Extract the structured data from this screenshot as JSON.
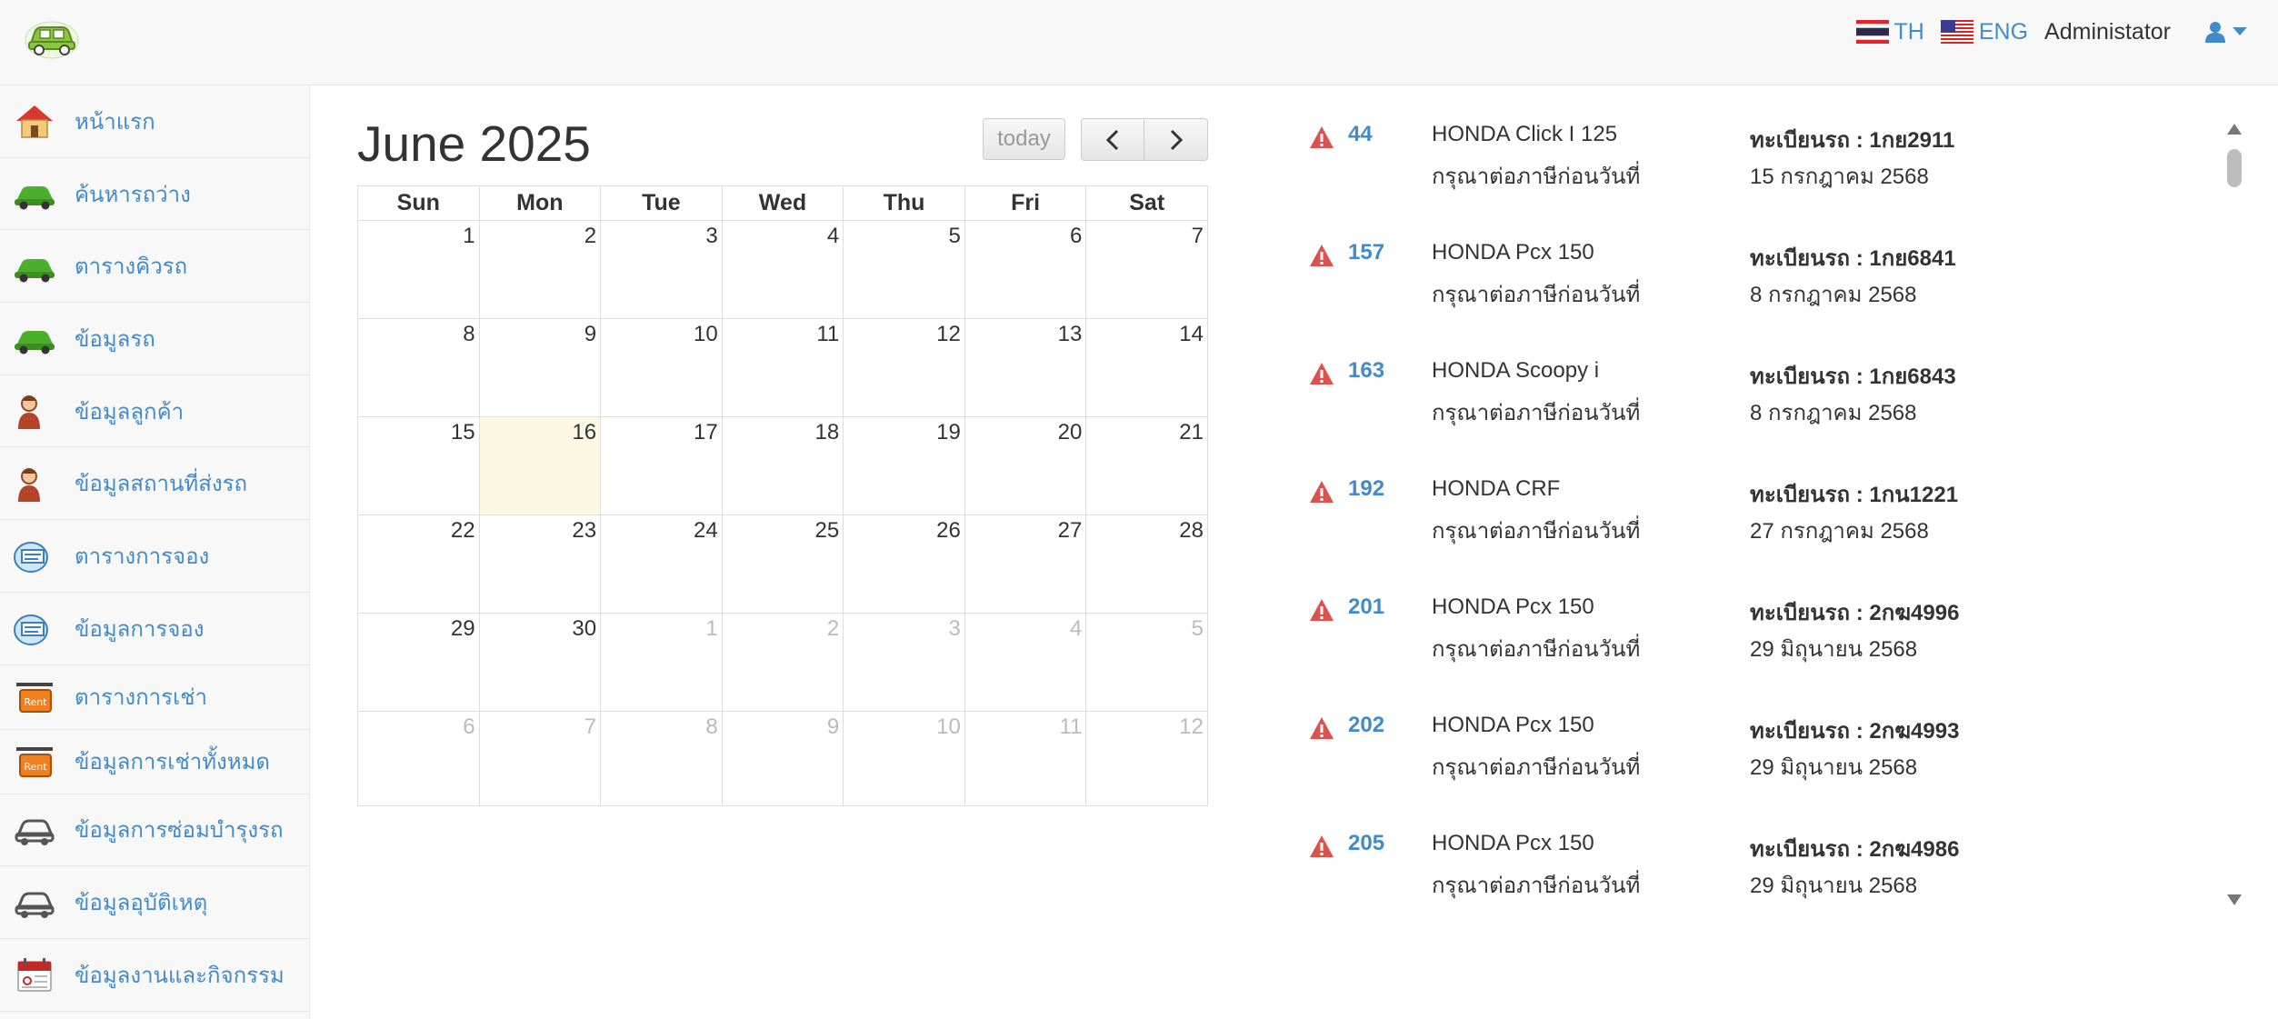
{
  "header": {
    "lang_th": "TH",
    "lang_eng": "ENG",
    "user_name": "Administator"
  },
  "sidebar": {
    "items": [
      {
        "label": "หน้าแรก",
        "icon": "home-icon"
      },
      {
        "label": "ค้นหารถว่าง",
        "icon": "green-car-icon"
      },
      {
        "label": "ตารางคิวรถ",
        "icon": "green-car-icon"
      },
      {
        "label": "ข้อมูลรถ",
        "icon": "green-car-icon"
      },
      {
        "label": "ข้อมูลลูกค้า",
        "icon": "person-icon"
      },
      {
        "label": "ข้อมูลสถานที่ส่งรถ",
        "icon": "person-icon"
      },
      {
        "label": "ตารางการจอง",
        "icon": "booking-icon"
      },
      {
        "label": "ข้อมูลการจอง",
        "icon": "booking-icon"
      },
      {
        "label": "ตารางการเช่า",
        "icon": "rent-sign-icon"
      },
      {
        "label": "ข้อมูลการเช่าทั้งหมด",
        "icon": "rent-sign-icon"
      },
      {
        "label": "ข้อมูลการซ่อมบำรุงรถ",
        "icon": "grey-car-icon"
      },
      {
        "label": "ข้อมูลอุบัติเหตุ",
        "icon": "grey-car-icon"
      },
      {
        "label": "ข้อมูลงานและกิจกรรม",
        "icon": "calendar-icon"
      }
    ]
  },
  "calendar": {
    "title": "June 2025",
    "today_label": "today",
    "weekdays": [
      "Sun",
      "Mon",
      "Tue",
      "Wed",
      "Thu",
      "Fri",
      "Sat"
    ],
    "weeks": [
      [
        {
          "d": "1"
        },
        {
          "d": "2"
        },
        {
          "d": "3"
        },
        {
          "d": "4"
        },
        {
          "d": "5"
        },
        {
          "d": "6"
        },
        {
          "d": "7"
        }
      ],
      [
        {
          "d": "8"
        },
        {
          "d": "9"
        },
        {
          "d": "10"
        },
        {
          "d": "11"
        },
        {
          "d": "12"
        },
        {
          "d": "13"
        },
        {
          "d": "14"
        }
      ],
      [
        {
          "d": "15"
        },
        {
          "d": "16",
          "today": true
        },
        {
          "d": "17"
        },
        {
          "d": "18"
        },
        {
          "d": "19"
        },
        {
          "d": "20"
        },
        {
          "d": "21"
        }
      ],
      [
        {
          "d": "22"
        },
        {
          "d": "23"
        },
        {
          "d": "24"
        },
        {
          "d": "25"
        },
        {
          "d": "26"
        },
        {
          "d": "27"
        },
        {
          "d": "28"
        }
      ],
      [
        {
          "d": "29"
        },
        {
          "d": "30"
        },
        {
          "d": "1",
          "other": true
        },
        {
          "d": "2",
          "other": true
        },
        {
          "d": "3",
          "other": true
        },
        {
          "d": "4",
          "other": true
        },
        {
          "d": "5",
          "other": true
        }
      ],
      [
        {
          "d": "6",
          "other": true
        },
        {
          "d": "7",
          "other": true
        },
        {
          "d": "8",
          "other": true
        },
        {
          "d": "9",
          "other": true
        },
        {
          "d": "10",
          "other": true
        },
        {
          "d": "11",
          "other": true
        },
        {
          "d": "12",
          "other": true
        }
      ]
    ]
  },
  "alerts": {
    "note_label": "กรุณาต่อภาษีก่อนวันที่",
    "items": [
      {
        "id": "44",
        "model": "HONDA Click I 125",
        "plate": "ทะเบียนรถ : 1กย2911",
        "date": "15 กรกฎาคม 2568"
      },
      {
        "id": "157",
        "model": "HONDA Pcx 150",
        "plate": "ทะเบียนรถ : 1กย6841",
        "date": "8 กรกฎาคม 2568"
      },
      {
        "id": "163",
        "model": "HONDA Scoopy i",
        "plate": "ทะเบียนรถ : 1กย6843",
        "date": "8 กรกฎาคม 2568"
      },
      {
        "id": "192",
        "model": "HONDA CRF",
        "plate": "ทะเบียนรถ : 1กน1221",
        "date": "27 กรกฎาคม 2568"
      },
      {
        "id": "201",
        "model": "HONDA Pcx 150",
        "plate": "ทะเบียนรถ : 2กฆ4996",
        "date": "29 มิถุนายน 2568"
      },
      {
        "id": "202",
        "model": "HONDA Pcx 150",
        "plate": "ทะเบียนรถ : 2กฆ4993",
        "date": "29 มิถุนายน 2568"
      },
      {
        "id": "205",
        "model": "HONDA Pcx 150",
        "plate": "ทะเบียนรถ : 2กฆ4986",
        "date": "29 มิถุนายน 2568"
      }
    ]
  }
}
